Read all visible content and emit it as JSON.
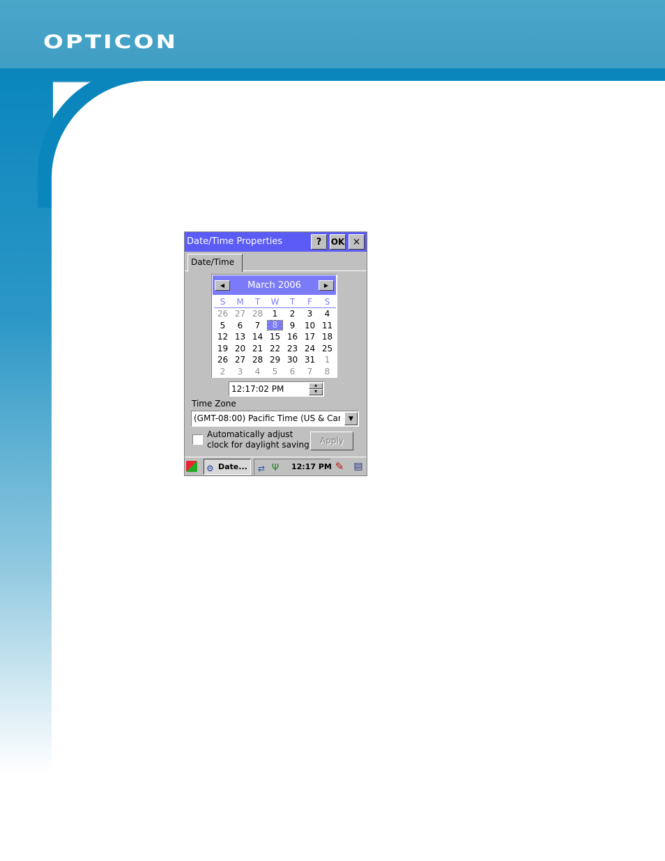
{
  "page": {
    "logo_text": "OPTICON",
    "brand_color": "#0a86bd"
  },
  "dialog": {
    "title": "Date/Time Properties",
    "help_label": "?",
    "ok_label": "OK",
    "close_label": "×",
    "tab_label": "Date/Time"
  },
  "calendar": {
    "month_label": "March 2006",
    "prev_icon": "left-triangle",
    "next_icon": "right-triangle",
    "weekdays": [
      "S",
      "M",
      "T",
      "W",
      "T",
      "F",
      "S"
    ],
    "weeks": [
      [
        "26",
        "27",
        "28",
        "1",
        "2",
        "3",
        "4"
      ],
      [
        "5",
        "6",
        "7",
        "8",
        "9",
        "10",
        "11"
      ],
      [
        "12",
        "13",
        "14",
        "15",
        "16",
        "17",
        "18"
      ],
      [
        "19",
        "20",
        "21",
        "22",
        "23",
        "24",
        "25"
      ],
      [
        "26",
        "27",
        "28",
        "29",
        "30",
        "31",
        "1"
      ],
      [
        "2",
        "3",
        "4",
        "5",
        "6",
        "7",
        "8"
      ]
    ],
    "selected_day": "8",
    "accent_color": "#7b7bf7"
  },
  "time": {
    "value": "12:17:02 PM"
  },
  "timezone": {
    "label": "Time Zone",
    "value": "(GMT-08:00) Pacific Time (US & Can"
  },
  "daylight": {
    "label_line1": "Automatically adjust",
    "label_line2": "clock for daylight saving",
    "checked": false,
    "apply_label": "Apply"
  },
  "taskbar": {
    "task_label": "Date...",
    "clock": "12:17 PM"
  }
}
